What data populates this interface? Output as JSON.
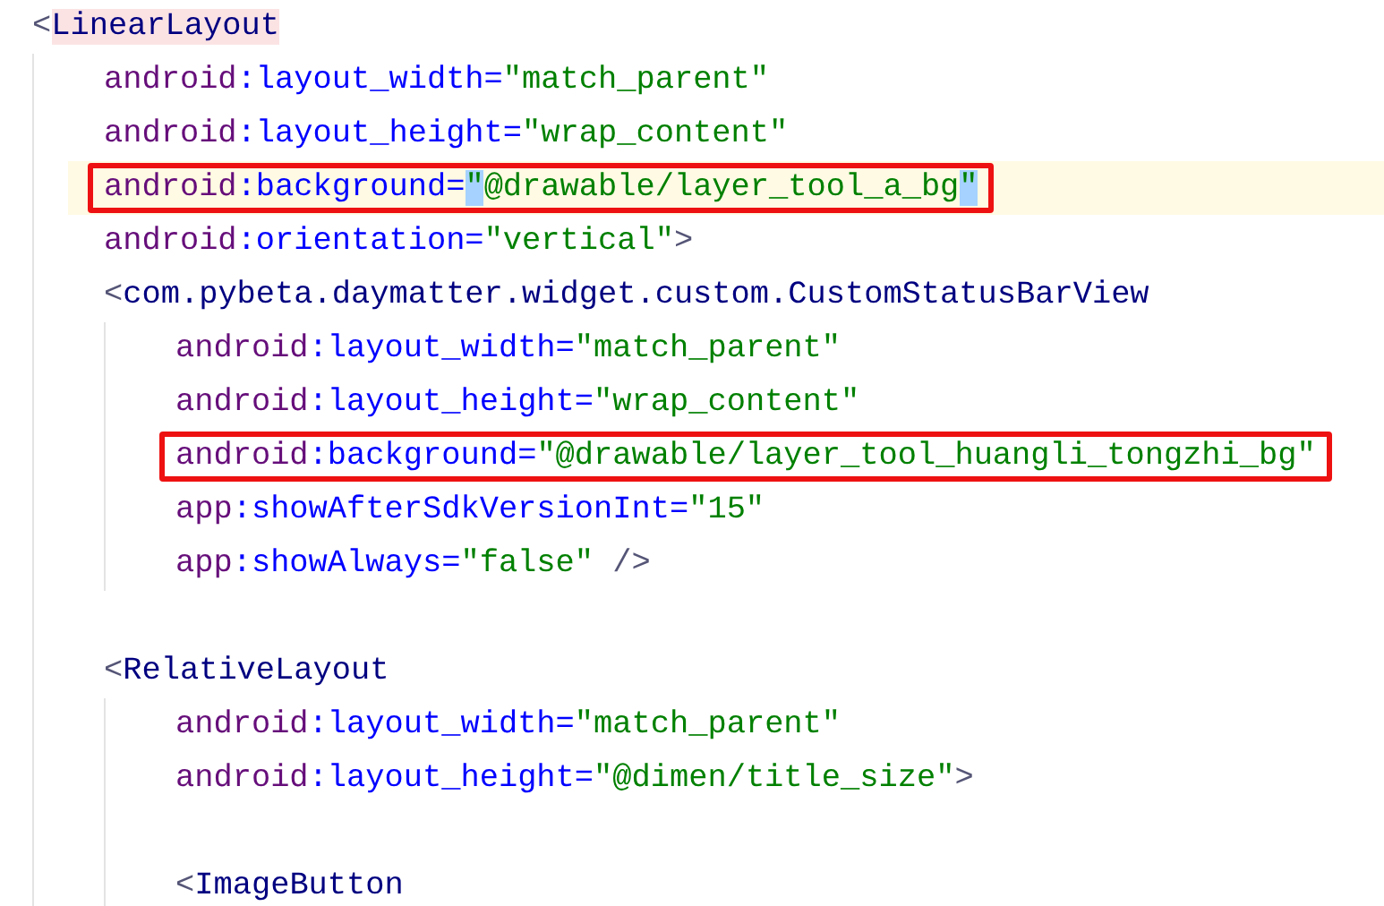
{
  "editor": {
    "lines": [
      {
        "kind": "code",
        "current": false,
        "boxed": false,
        "tokens": [
          {
            "kind": "bracket",
            "text": "<"
          },
          {
            "kind": "matched_tag",
            "text": "LinearLayout"
          }
        ],
        "children": [
          {
            "kind": "code",
            "current": false,
            "boxed": false,
            "tokens": [
              {
                "kind": "ns",
                "text": "android"
              },
              {
                "kind": "attr",
                "text": ":layout_width="
              },
              {
                "kind": "value",
                "text": "\"match_parent\""
              }
            ]
          },
          {
            "kind": "code",
            "current": false,
            "boxed": false,
            "tokens": [
              {
                "kind": "ns",
                "text": "android"
              },
              {
                "kind": "attr",
                "text": ":layout_height="
              },
              {
                "kind": "value",
                "text": "\"wrap_content\""
              }
            ]
          },
          {
            "kind": "code",
            "current": true,
            "boxed": true,
            "tokens": [
              {
                "kind": "ns",
                "text": "android"
              },
              {
                "kind": "attr",
                "text": ":background="
              },
              {
                "kind": "selected_value",
                "text": "\""
              },
              {
                "kind": "value",
                "text": "@drawable/layer_tool_a_bg"
              },
              {
                "kind": "selected_value",
                "text": "\""
              }
            ]
          },
          {
            "kind": "code",
            "current": false,
            "boxed": false,
            "tokens": [
              {
                "kind": "ns",
                "text": "android"
              },
              {
                "kind": "attr",
                "text": ":orientation="
              },
              {
                "kind": "value",
                "text": "\"vertical\""
              },
              {
                "kind": "bracket",
                "text": ">"
              }
            ]
          },
          {
            "kind": "code",
            "current": false,
            "boxed": false,
            "tokens": [
              {
                "kind": "bracket",
                "text": "<"
              },
              {
                "kind": "tag",
                "text": "com.pybeta.daymatter.widget.custom.CustomStatusBarView"
              }
            ],
            "children": [
              {
                "kind": "code",
                "current": false,
                "boxed": false,
                "tokens": [
                  {
                    "kind": "ns",
                    "text": "android"
                  },
                  {
                    "kind": "attr",
                    "text": ":layout_width="
                  },
                  {
                    "kind": "value",
                    "text": "\"match_parent\""
                  }
                ]
              },
              {
                "kind": "code",
                "current": false,
                "boxed": false,
                "tokens": [
                  {
                    "kind": "ns",
                    "text": "android"
                  },
                  {
                    "kind": "attr",
                    "text": ":layout_height="
                  },
                  {
                    "kind": "value",
                    "text": "\"wrap_content\""
                  }
                ]
              },
              {
                "kind": "code",
                "current": false,
                "boxed": true,
                "tokens": [
                  {
                    "kind": "ns",
                    "text": "android"
                  },
                  {
                    "kind": "attr",
                    "text": ":background="
                  },
                  {
                    "kind": "value",
                    "text": "\"@drawable/layer_tool_huangli_tongzhi_bg\""
                  }
                ]
              },
              {
                "kind": "code",
                "current": false,
                "boxed": false,
                "tokens": [
                  {
                    "kind": "ns",
                    "text": "app"
                  },
                  {
                    "kind": "attr",
                    "text": ":showAfterSdkVersionInt="
                  },
                  {
                    "kind": "value",
                    "text": "\"15\""
                  }
                ]
              },
              {
                "kind": "code",
                "current": false,
                "boxed": false,
                "tokens": [
                  {
                    "kind": "ns",
                    "text": "app"
                  },
                  {
                    "kind": "attr",
                    "text": ":showAlways="
                  },
                  {
                    "kind": "value",
                    "text": "\"false\""
                  },
                  {
                    "kind": "bracket",
                    "text": " />"
                  }
                ]
              }
            ]
          },
          {
            "kind": "blank"
          },
          {
            "kind": "code",
            "current": false,
            "boxed": false,
            "tokens": [
              {
                "kind": "bracket",
                "text": "<"
              },
              {
                "kind": "tag",
                "text": "RelativeLayout"
              }
            ],
            "children": [
              {
                "kind": "code",
                "current": false,
                "boxed": false,
                "tokens": [
                  {
                    "kind": "ns",
                    "text": "android"
                  },
                  {
                    "kind": "attr",
                    "text": ":layout_width="
                  },
                  {
                    "kind": "value",
                    "text": "\"match_parent\""
                  }
                ]
              },
              {
                "kind": "code",
                "current": false,
                "boxed": false,
                "tokens": [
                  {
                    "kind": "ns",
                    "text": "android"
                  },
                  {
                    "kind": "attr",
                    "text": ":layout_height="
                  },
                  {
                    "kind": "value",
                    "text": "\"@dimen/title_size\""
                  },
                  {
                    "kind": "bracket",
                    "text": ">"
                  }
                ]
              },
              {
                "kind": "blank"
              },
              {
                "kind": "code",
                "current": false,
                "boxed": false,
                "tokens": [
                  {
                    "kind": "bracket",
                    "text": "<"
                  },
                  {
                    "kind": "tag",
                    "text": "ImageButton"
                  }
                ]
              }
            ]
          }
        ]
      }
    ]
  }
}
